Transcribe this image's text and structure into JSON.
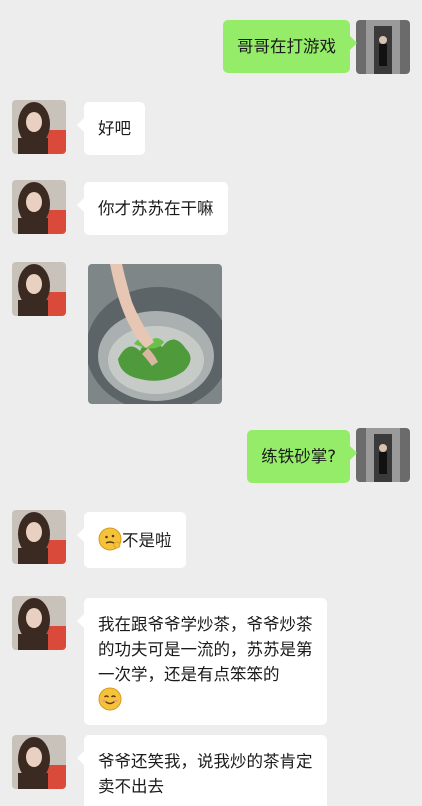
{
  "messages": [
    {
      "id": "m1",
      "side": "right",
      "text": "哥哥在打游戏"
    },
    {
      "id": "m2",
      "side": "left",
      "text": "好吧"
    },
    {
      "id": "m3",
      "side": "left",
      "text": "你才苏苏在干嘛"
    },
    {
      "id": "m4",
      "side": "left",
      "type": "image",
      "image_desc": "hand stirring green tea leaves in a metal wok"
    },
    {
      "id": "m5",
      "side": "right",
      "text": "练铁砂掌?"
    },
    {
      "id": "m6",
      "side": "left",
      "emoji": "thinking-emoji",
      "text": "不是啦"
    },
    {
      "id": "m7",
      "side": "left",
      "lines": [
        "我在跟爷爷学炒茶，爷爷炒茶",
        "的功夫可是一流的，苏苏是第",
        "一次学，还是有点笨笨的"
      ],
      "emoji_end": "smile-emoji"
    },
    {
      "id": "m8",
      "side": "left",
      "lines": [
        "爷爷还笑我，说我炒的茶肯定",
        "卖不出去"
      ]
    }
  ],
  "colors": {
    "background": "#ededed",
    "incoming_bubble": "#ffffff",
    "outgoing_bubble": "#95ec69"
  }
}
